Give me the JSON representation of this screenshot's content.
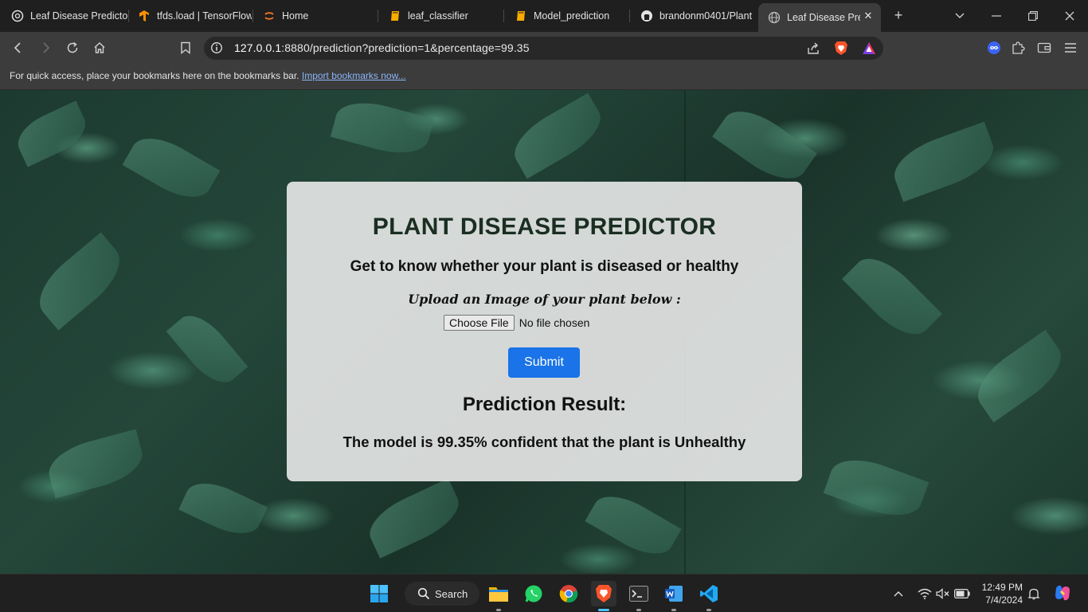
{
  "tabs": [
    {
      "label": "Leaf Disease Predictor",
      "icon": "openai-icon"
    },
    {
      "label": "tfds.load | TensorFlow",
      "icon": "tensorflow-icon"
    },
    {
      "label": "Home",
      "icon": "jupyter-icon"
    },
    {
      "label": "leaf_classifier",
      "icon": "notebook-icon"
    },
    {
      "label": "Model_prediction",
      "icon": "notebook-icon"
    },
    {
      "label": "brandonm0401/Plant",
      "icon": "github-icon"
    },
    {
      "label": "Leaf Disease Predictor",
      "icon": "globe-icon",
      "active": true
    }
  ],
  "address_bar": {
    "host": "127.0.0.1",
    "rest": ":8880/prediction?prediction=1&percentage=99.35"
  },
  "bookmarks_bar": {
    "message": "For quick access, place your bookmarks here on the bookmarks bar.",
    "link": "Import bookmarks now..."
  },
  "page": {
    "title": "PLANT DISEASE PREDICTOR",
    "subtitle": "Get to know whether your plant is diseased or healthy",
    "upload_label": "Upload an Image of your plant below :",
    "file_button": "Choose File",
    "file_status": "No file chosen",
    "submit_label": "Submit",
    "result_heading": "Prediction Result:",
    "result_text": "The model is 99.35% confident that the plant is Unhealthy"
  },
  "taskbar": {
    "search_label": "Search",
    "time": "12:49 PM",
    "date": "7/4/2024"
  },
  "colors": {
    "accent": "#1a73e8",
    "title": "#1a2e22",
    "active_indicator": "#4cc2ff"
  }
}
